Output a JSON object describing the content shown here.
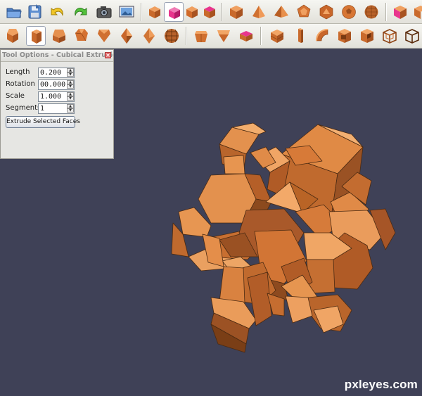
{
  "colors": {
    "viewport_bg": "#3f4157",
    "shape_orange": "#e38a45",
    "shape_dark": "#9a5528",
    "highlight_magenta": "#e8358d"
  },
  "toolbar_top": {
    "icons": [
      "open-folder-icon",
      "save-icon",
      "undo-icon",
      "redo-icon",
      "camera-icon",
      "image-icon",
      "cube-icon",
      "cube-selected-icon",
      "cube-face-icon",
      "cube-highlight-icon",
      "cube-icon",
      "tetrahedron-icon",
      "pyramid-icon",
      "dodecahedron-icon",
      "icosahedron-icon",
      "soccerball-icon",
      "sphere-icon",
      "cube-highlight-icon",
      "cube-extrude-icon"
    ]
  },
  "toolbar_bottom": {
    "icons": [
      "cube-icon",
      "cube-beveled-icon",
      "cube-truncated-icon",
      "cube-chamfered-icon",
      "cube-extrude-icon",
      "octahedron-icon",
      "bipyramid-icon",
      "geosphere-icon",
      "prism-icon",
      "cube-cut-icon",
      "cube-highlight-icon",
      "quarter-cube-icon",
      "slab-icon",
      "torus-icon",
      "cube-corner-icon",
      "cube-notch-icon",
      "wireframe-cube-icon",
      "wireframe-box-icon"
    ]
  },
  "tool_options": {
    "title": "Tool Options - Cubical Extrusion",
    "length_label": "Length",
    "length_value": "0.200",
    "rotation_label": "Rotation",
    "rotation_value": "00.000",
    "scale_label": "Scale",
    "scale_value": "1.000",
    "segments_label": "Segments",
    "segments_value": "1",
    "extrude_button_label": "Extrude Selected Faces"
  },
  "watermark": "pxleyes.com"
}
